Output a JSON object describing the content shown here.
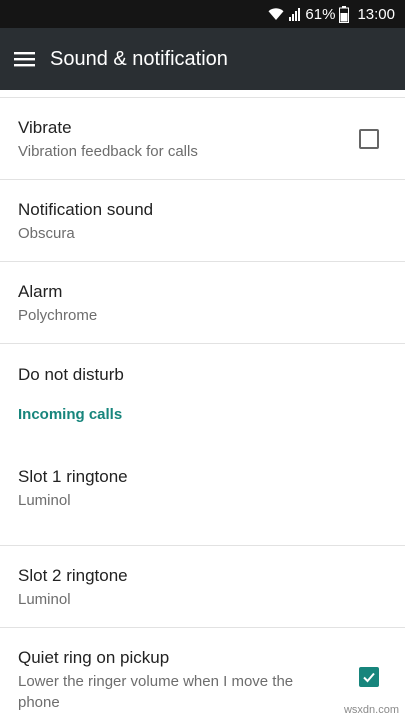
{
  "status_bar": {
    "battery_percent": "61%",
    "time": "13:00",
    "icons": [
      "wifi-icon",
      "signal-icon",
      "battery-icon"
    ]
  },
  "app_bar": {
    "menu_icon": "hamburger-menu-icon",
    "title": "Sound & notification"
  },
  "settings": [
    {
      "title": "Vibrate",
      "subtitle": "Vibration feedback for calls",
      "checkbox": false
    },
    {
      "title": "Notification sound",
      "subtitle": "Obscura"
    },
    {
      "title": "Alarm",
      "subtitle": "Polychrome"
    },
    {
      "title": "Do not disturb"
    }
  ],
  "section_header": "Incoming calls",
  "incoming_calls": [
    {
      "title": "Slot 1 ringtone",
      "subtitle": "Luminol"
    },
    {
      "title": "Slot 2 ringtone",
      "subtitle": "Luminol"
    },
    {
      "title": "Quiet ring on pickup",
      "subtitle": "Lower the ringer volume when I move the phone",
      "checkbox": true
    }
  ],
  "watermark": "wsxdn.com",
  "colors": {
    "accent": "#17857c",
    "app_bar": "#2a2f33",
    "status_bar": "#151515"
  }
}
